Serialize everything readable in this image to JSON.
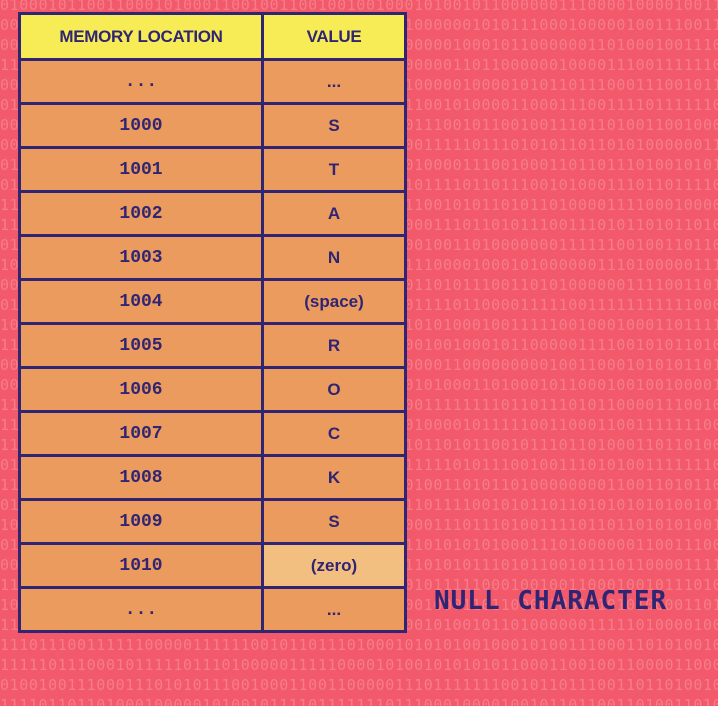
{
  "table": {
    "headers": {
      "location": "MEMORY LOCATION",
      "value": "VALUE"
    },
    "rows": [
      {
        "location": "...",
        "value": "..."
      },
      {
        "location": "1000",
        "value": "S"
      },
      {
        "location": "1001",
        "value": "T"
      },
      {
        "location": "1002",
        "value": "A"
      },
      {
        "location": "1003",
        "value": "N"
      },
      {
        "location": "1004",
        "value": "(space)"
      },
      {
        "location": "1005",
        "value": "R"
      },
      {
        "location": "1006",
        "value": "O"
      },
      {
        "location": "1007",
        "value": "C"
      },
      {
        "location": "1008",
        "value": "K"
      },
      {
        "location": "1009",
        "value": "S"
      },
      {
        "location": "1010",
        "value": "(zero)",
        "highlighted": true
      },
      {
        "location": "...",
        "value": "..."
      }
    ]
  },
  "annotation": {
    "label": "NULL CHARACTER"
  },
  "colors": {
    "background": "#f2596b",
    "header": "#f7ec55",
    "cell": "#ec9b5f",
    "highlight_cell": "#f3bf80",
    "ink": "#2f2573"
  }
}
